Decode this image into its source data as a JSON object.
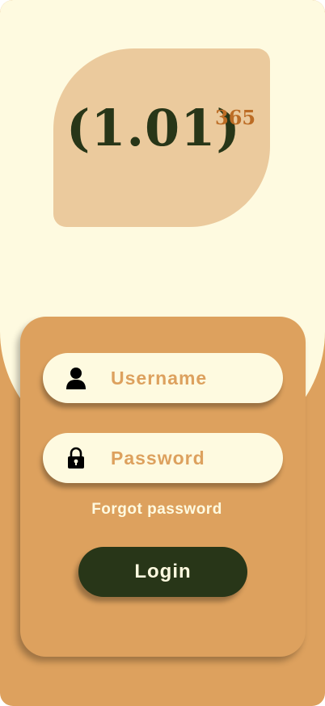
{
  "logo": {
    "base": "(1.01)",
    "exponent": "365"
  },
  "form": {
    "username_placeholder": "Username",
    "password_placeholder": "Password",
    "username_icon": "user-icon",
    "password_icon": "lock-icon",
    "forgot_label": "Forgot password",
    "login_label": "Login"
  },
  "colors": {
    "background_light": "#FEFAE0",
    "accent_orange": "#DDA15E",
    "logo_tile": "#EBCA9D",
    "dark_green": "#283618",
    "exponent_brown": "#BC6C25"
  }
}
